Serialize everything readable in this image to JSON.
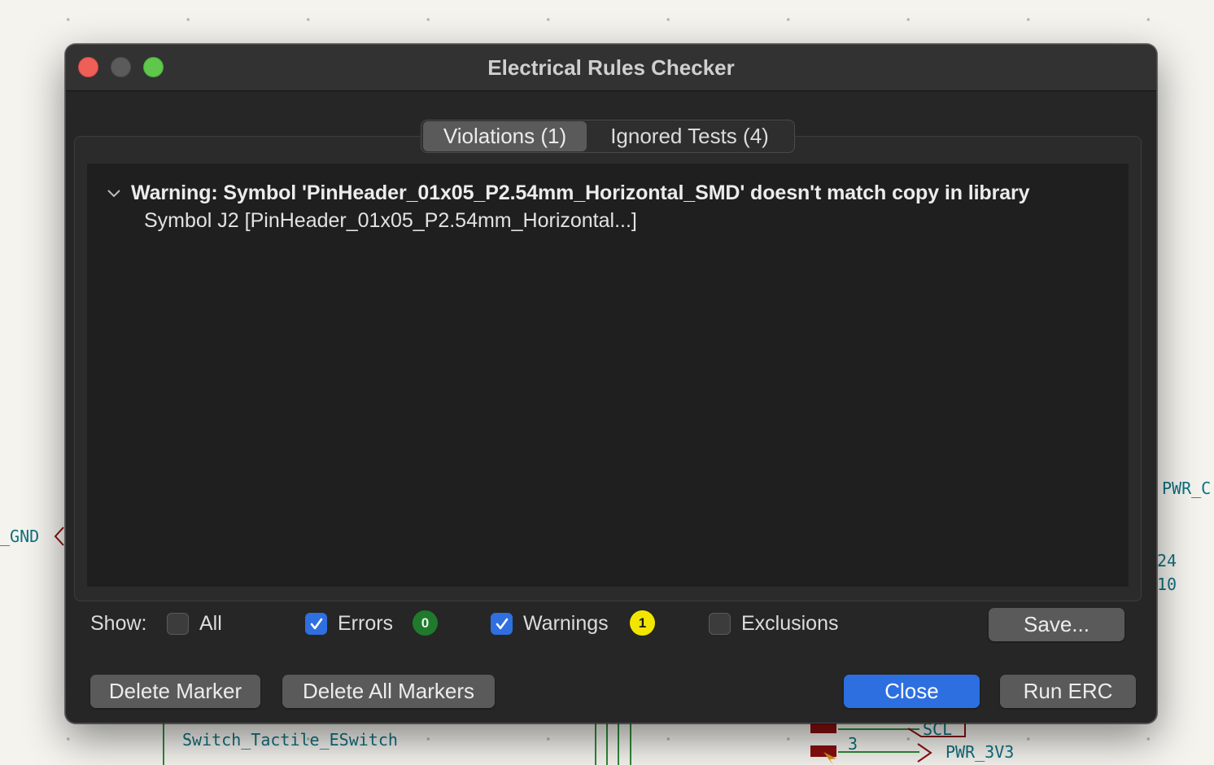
{
  "window": {
    "title": "Electrical Rules Checker"
  },
  "tabs": [
    {
      "label": "Violations (1)",
      "active": true
    },
    {
      "label": "Ignored Tests (4)",
      "active": false
    }
  ],
  "violations": [
    {
      "severity": "Warning",
      "message": "Warning: Symbol 'PinHeader_01x05_P2.54mm_Horizontal_SMD' doesn't match copy in library",
      "detail": "Symbol J2 [PinHeader_01x05_P2.54mm_Horizontal...]",
      "expanded": true
    }
  ],
  "filters": {
    "show_label": "Show:",
    "all": {
      "label": "All",
      "checked": false
    },
    "errors": {
      "label": "Errors",
      "checked": true,
      "count": "0"
    },
    "warnings": {
      "label": "Warnings",
      "checked": true,
      "count": "1"
    },
    "exclusions": {
      "label": "Exclusions",
      "checked": false
    }
  },
  "buttons": {
    "save": "Save...",
    "delete_marker": "Delete Marker",
    "delete_all_markers": "Delete All Markers",
    "close": "Close",
    "run_erc": "Run ERC"
  },
  "background": {
    "labels": {
      "gnd": "_GND",
      "pwr_top": "PWR_C",
      "side_a": "24",
      "side_b": "10",
      "switch": "Switch_Tactile_ESwitch",
      "scl": "SCL",
      "pin3": "3",
      "pwr_3v3": "PWR_3V3"
    }
  },
  "colors": {
    "accent": "#2d6fe0",
    "errors_badge": "#1f7a2c",
    "warnings_badge": "#f2e600",
    "schematic_label": "#0f6f7f",
    "schematic_wire": "#2f8a3a",
    "schematic_pad": "#8a0f0f"
  }
}
